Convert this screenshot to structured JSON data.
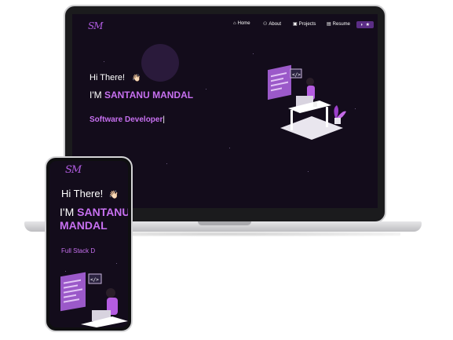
{
  "laptop": {
    "logo": "SM",
    "nav": {
      "home": "Home",
      "about": "About",
      "projects": "Projects",
      "resume": "Resume"
    },
    "toggle_icons": [
      "◗",
      "★"
    ],
    "greeting": "Hi There!",
    "wave_emoji": "👋🏻",
    "intro_prefix": "I'M ",
    "name": "SANTANU MANDAL",
    "role": "Software Developer"
  },
  "phone": {
    "logo": "SM",
    "greeting": "Hi There!",
    "wave_emoji": "👋🏻",
    "intro_prefix": "I'M ",
    "name_line1": "SANTANU",
    "name_line2": "MANDAL",
    "role_partial": "Full Stack D"
  },
  "colors": {
    "background": "#130c1b",
    "accent": "#c770f0",
    "frame": "#1b1b1d"
  }
}
